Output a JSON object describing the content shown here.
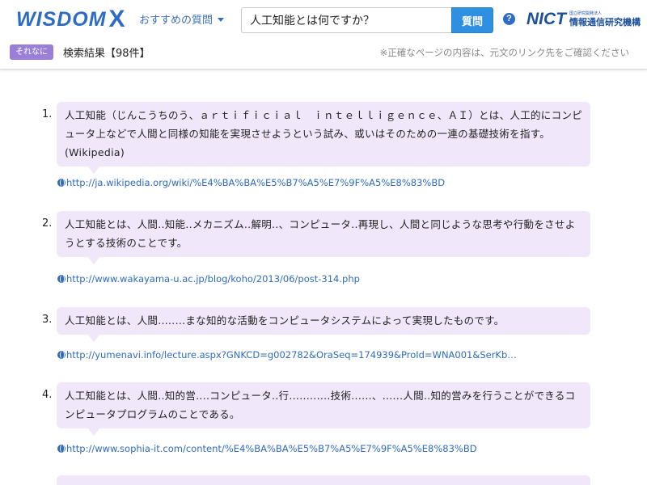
{
  "header": {
    "logo_text": "WISDOM",
    "logo_x": "X",
    "faq_label": "おすすめの質問",
    "search_value": "人工知能とは何ですか？",
    "search_button": "質問",
    "help_icon": "?",
    "nict": {
      "mark": "NICT",
      "sub": "国立研究開発法人",
      "name": "情報通信研究機構"
    }
  },
  "result_bar": {
    "badge": "それなに",
    "count": "検索結果【98件】",
    "notice": "※正確なページの内容は、元文のリンク先をご確認ください"
  },
  "results": [
    {
      "number": "1.",
      "text": "人工知能（じんこうちのう、ａｒｔｉｆｉｃｉａｌ　ｉｎｔｅｌｌｉｇｅｎｃｅ、ＡＩ）とは、人工的にコンピュータ上などで人間と同様の知能を実現させようという試み、或いはそのための一連の基礎技術を指す。 (Wikipedia)",
      "url": "http://ja.wikipedia.org/wiki/%E4%BA%BA%E5%B7%A5%E7%9F%A5%E8%83%BD"
    },
    {
      "number": "2.",
      "text": "人工知能とは、人間..知能..メカニズム..解明..、コンピュータ..再現し、人間と同じような思考や行動をさせようとする技術のことです。",
      "url": "http://www.wakayama-u.ac.jp/blog/koho/2013/06/post-314.php"
    },
    {
      "number": "3.",
      "text": "人工知能とは、人間........まな知的な活動をコンピュータシステムによって実現したものです。",
      "url": "http://yumenavi.info/lecture.aspx?GNKCD=g002782&OraSeq=174939&ProId=WNA001&SerKb…"
    },
    {
      "number": "4.",
      "text": "人工知能とは、人間..知的営....コンピュータ..行............技術......、......人間..知的営みを行うことができるコンピュータプログラムのことである。",
      "url": "http://www.sophia-it.com/content/%E4%BA%BA%E5%B7%A5%E7%9F%A5%E8%83%BD"
    },
    {
      "number": "",
      "text": "",
      "url": ""
    }
  ],
  "colors": {
    "brand_blue": "#2d6cc4",
    "search_button": "#2f8fe0",
    "badge_purple": "#9a7fd6",
    "bubble_bg": "#f0e7fb",
    "link_blue": "#2f6bbf"
  },
  "icons": {
    "faq_caret": "caret-down-icon",
    "help": "help-icon",
    "link": "globe-icon"
  }
}
